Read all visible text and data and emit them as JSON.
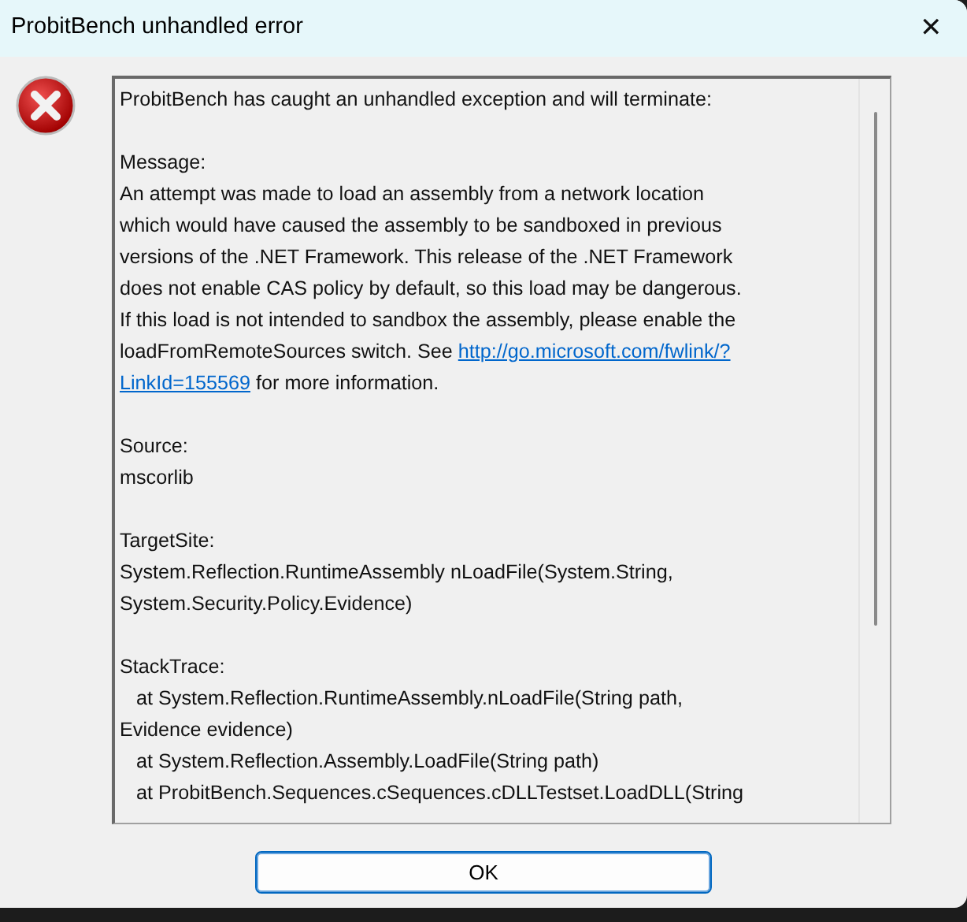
{
  "window": {
    "title": "ProbitBench unhandled error",
    "close": "✕"
  },
  "details": {
    "intro": "ProbitBench has caught an unhandled exception and will terminate:",
    "message": {
      "label": "Message:",
      "text": "An attempt was made to load an assembly from a network location\nwhich would have caused the assembly to be sandboxed in previous\nversions of the .NET Framework. This release of the .NET Framework\ndoes not enable CAS policy by default, so this load may be dangerous.\nIf this load is not intended to sandbox the assembly, please enable the\nloadFromRemoteSources switch. See ",
      "link": [
        "http://go.microsoft.com/fwlink/?",
        "LinkId=155569"
      ],
      "after": " for more information."
    },
    "source": {
      "label": "Source:",
      "text": "mscorlib"
    },
    "target_site": {
      "label": "TargetSite:",
      "text": "System.Reflection.RuntimeAssembly nLoadFile(System.String,\nSystem.Security.Policy.Evidence)"
    },
    "stack_trace": {
      "label": "StackTrace:",
      "lines": [
        "   at System.Reflection.RuntimeAssembly.nLoadFile(String path,\nEvidence evidence)",
        "   at System.Reflection.Assembly.LoadFile(String path)",
        "   at ProbitBench.Sequences.cSequences.cDLLTestset.LoadDLL(String"
      ]
    }
  },
  "buttons": [
    {
      "label": "OK",
      "default": true
    }
  ]
}
